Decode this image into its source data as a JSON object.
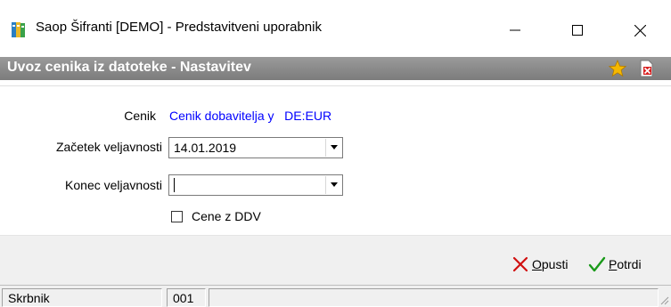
{
  "window": {
    "title": "Saop Šifranti [DEMO] - Predstavitveni uporabnik",
    "icons": {
      "app": "books-icon",
      "minimize": "minimize-icon",
      "maximize": "maximize-icon",
      "close": "close-icon"
    }
  },
  "header": {
    "title": "Uvoz cenika iz datoteke - Nastavitev",
    "icons": [
      "star-icon",
      "delete-document-icon"
    ],
    "colors": {
      "background": "#8a8a8a",
      "star": "#f5b800",
      "delete": "#d82020"
    }
  },
  "form": {
    "cenik": {
      "label": "Cenik",
      "value": "Cenik dobavitelja y   DE:EUR",
      "color": "#0000ff"
    },
    "zacetek": {
      "label": "Začetek veljavnosti",
      "value": "14.01.2019"
    },
    "konec": {
      "label": "Konec veljavnosti",
      "value": ""
    },
    "cene_z_ddv": {
      "label": "Cene z DDV",
      "checked": false
    }
  },
  "actions": {
    "cancel": {
      "underline": "O",
      "rest": "pusti",
      "icon": "x-icon",
      "color": "#d01010"
    },
    "confirm": {
      "underline": "P",
      "rest": "otrdi",
      "icon": "checkmark-icon",
      "color": "#1a9a1a"
    }
  },
  "statusbar": {
    "user": "Skrbnik",
    "code": "001",
    "info": ""
  }
}
